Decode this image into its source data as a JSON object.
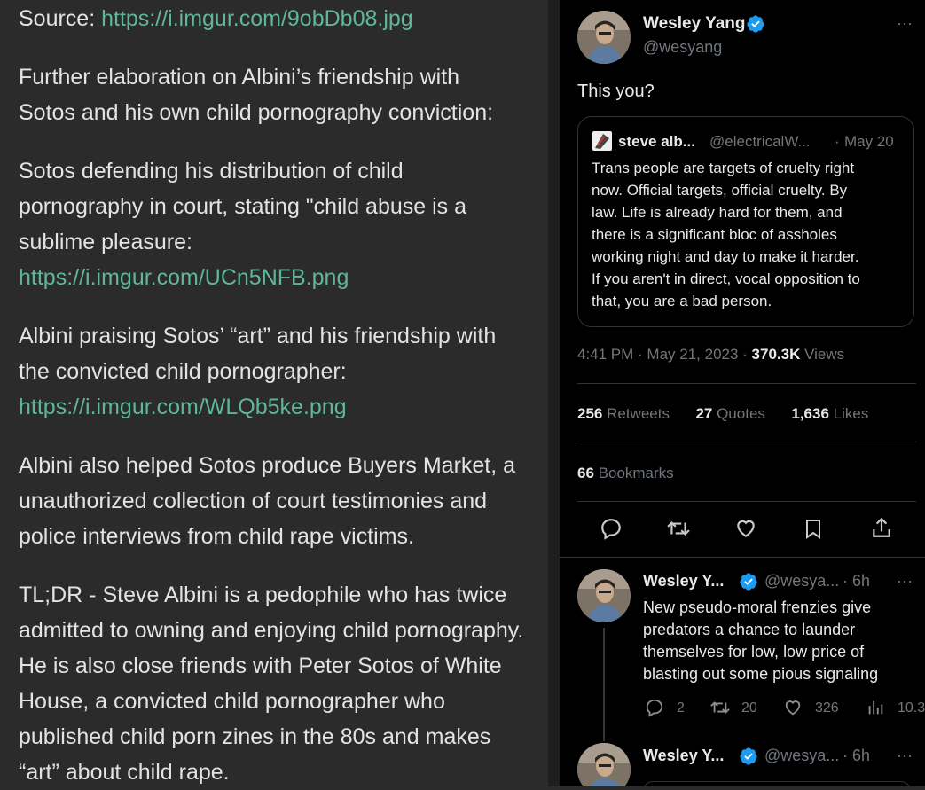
{
  "article": {
    "source_label": "Source: ",
    "source_link": "https://i.imgur.com/9obDb08.jpg",
    "p2_line1": "Further elaboration on Albini’s friendship with",
    "p2_line2": "Sotos and his own child pornography conviction:",
    "p3_line1": "Sotos defending his distribution of child",
    "p3_line2": "pornography in court, stating \"child abuse is a",
    "p3_line3": "sublime pleasure:",
    "p3_link": "https://i.imgur.com/UCn5NFB.png",
    "p4_line1": "Albini praising Sotos’ “art” and his friendship with",
    "p4_line2": "the convicted child pornographer:",
    "p4_link": "https://i.imgur.com/WLQb5ke.png",
    "p5_line1": "Albini also helped Sotos produce Buyers Market, a",
    "p5_line2": "unauthorized collection of court testimonies and",
    "p5_line3": "police interviews from child rape victims.",
    "p6_line1": "TL;DR - Steve Albini is a pedophile who has twice",
    "p6_line2": "admitted to owning and enjoying child pornography.",
    "p6_line3": "He is also close friends with Peter Sotos of White",
    "p6_line4": "House, a convicted child pornographer who",
    "p6_line5": "published child porn zines in the 80s and makes",
    "p6_line6": "“art” about child rape."
  },
  "tweet": {
    "author_name": "Wesley Yang",
    "author_handle": "@wesyang",
    "more": "···",
    "text": "This you?",
    "quoted": {
      "name": "steve alb...",
      "handle": "@electricalW...",
      "dot": "·",
      "date": "May 20",
      "line1": "Trans people are targets of cruelty right",
      "line2": "now. Official targets, official cruelty. By",
      "line3": "law. Life is already hard for them, and",
      "line4": "there is a significant bloc of assholes",
      "line5": "working night and day to make it harder.",
      "line6": "If you aren't in direct, vocal opposition to",
      "line7": "that, you are a bad person."
    },
    "timestamp": "4:41 PM · May 21, 2023 · ",
    "views_count": "370.3K",
    "views_label": " Views",
    "retweets_count": "256",
    "retweets_label": " Retweets",
    "quotes_count": "27",
    "quotes_label": " Quotes",
    "likes_count": "1,636",
    "likes_label": " Likes",
    "bookmarks_count": "66",
    "bookmarks_label": " Bookmarks"
  },
  "reply1": {
    "name": "Wesley Y...",
    "handle": "@wesya...",
    "time": "· 6h",
    "more": "···",
    "line1": "New pseudo-moral frenzies give",
    "line2": "predators a chance to launder",
    "line3": "themselves for low, low price of",
    "line4": "blasting out some pious signaling",
    "replies": "2",
    "retweets": "20",
    "likes": "326",
    "views": "10.3"
  },
  "reply2": {
    "name": "Wesley Y...",
    "handle": "@wesya...",
    "time": "· 6h",
    "more": "···"
  },
  "colors": {
    "link": "#5fb796",
    "verified": "#1d9bf0",
    "muted": "#71767b"
  },
  "icons": [
    "verified-badge-icon",
    "reply-icon",
    "retweet-icon",
    "like-icon",
    "bookmark-icon",
    "share-icon",
    "views-icon",
    "more-icon"
  ]
}
